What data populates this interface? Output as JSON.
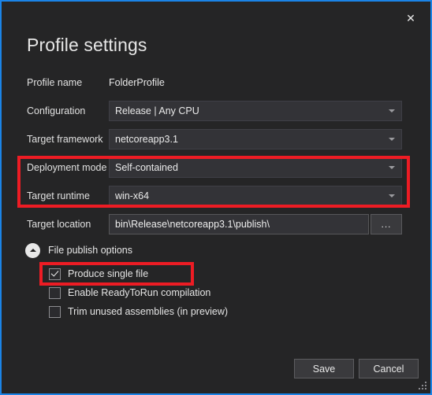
{
  "window": {
    "title": "Profile settings",
    "close_icon": "close-icon",
    "accent_border_color": "#1b84e7",
    "background_color": "#252526"
  },
  "fields": {
    "profile_name": {
      "label": "Profile name",
      "value": "FolderProfile",
      "type": "readonly-text"
    },
    "configuration": {
      "label": "Configuration",
      "value": "Release | Any CPU",
      "type": "combobox"
    },
    "target_framework": {
      "label": "Target framework",
      "value": "netcoreapp3.1",
      "type": "combobox"
    },
    "deployment_mode": {
      "label": "Deployment mode",
      "value": "Self-contained",
      "type": "combobox"
    },
    "target_runtime": {
      "label": "Target runtime",
      "value": "win-x64",
      "type": "combobox"
    },
    "target_location": {
      "label": "Target location",
      "value": "bin\\Release\\netcoreapp3.1\\publish\\",
      "type": "textbox"
    },
    "browse_button": {
      "label": "...",
      "icon": "ellipsis-icon"
    }
  },
  "file_publish_options": {
    "section_label": "File publish options",
    "expander_icon": "chevron-up-circle-icon",
    "expanded": true,
    "checkboxes": [
      {
        "label": "Produce single file",
        "checked": true
      },
      {
        "label": "Enable ReadyToRun compilation",
        "checked": false
      },
      {
        "label": "Trim unused assemblies (in preview)",
        "checked": false
      }
    ]
  },
  "footer": {
    "save_label": "Save",
    "cancel_label": "Cancel"
  },
  "annotations": {
    "color": "#ed1c24",
    "boxes": [
      {
        "name": "deployment-mode-and-target-runtime"
      },
      {
        "name": "produce-single-file"
      }
    ]
  }
}
